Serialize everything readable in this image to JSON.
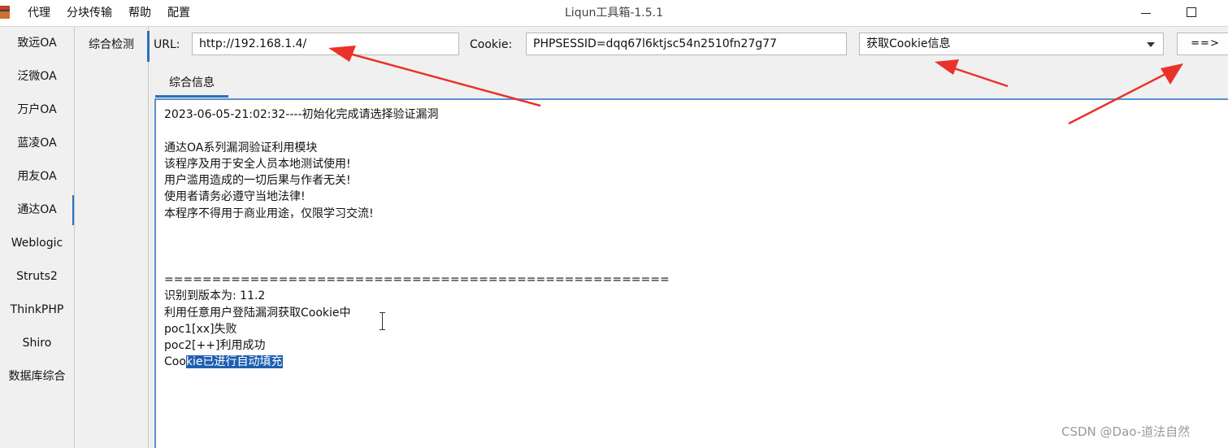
{
  "window": {
    "title": "Liqun工具箱-1.5.1",
    "menu": [
      "代理",
      "分块传输",
      "帮助",
      "配置"
    ]
  },
  "sidebar": {
    "items": [
      "致远OA",
      "泛微OA",
      "万户OA",
      "蓝凌OA",
      "用友OA",
      "通达OA",
      "Weblogic",
      "Struts2",
      "ThinkPHP",
      "Shiro",
      "数据库综合"
    ],
    "active": "通达OA"
  },
  "subtabs": {
    "items": [
      "综合检测"
    ]
  },
  "toolbar": {
    "url_label": "URL:",
    "url_value": "http://192.168.1.4/",
    "cookie_label": "Cookie:",
    "cookie_value": "PHPSESSID=dqq67l6ktjsc54n2510fn27g77",
    "action_select": "获取Cookie信息",
    "run_button": "==>"
  },
  "tabs": [
    "综合信息"
  ],
  "log": {
    "lines": [
      "2023-06-05-21:02:32----初始化完成请选择验证漏洞",
      "",
      "通达OA系列漏洞验证利用模块",
      "该程序及用于安全人员本地测试使用!",
      "用户滥用造成的一切后果与作者无关!",
      "使用者请务必遵守当地法律!",
      "本程序不得用于商业用途，仅限学习交流!",
      "",
      "",
      "",
      "=====================================================",
      "识别到版本为: 11.2",
      "利用任意用户登陆漏洞获取Cookie中",
      "poc1[xx]失败",
      "poc2[++]利用成功"
    ],
    "last_line_plain": "Coo",
    "last_line_selected": "kie已进行自动填充"
  },
  "watermark": "CSDN @Dao-道法自然",
  "colors": {
    "accent": "#2f6fb8",
    "selection": "#1f5fb0",
    "annotation_arrow": "#e8322a"
  }
}
